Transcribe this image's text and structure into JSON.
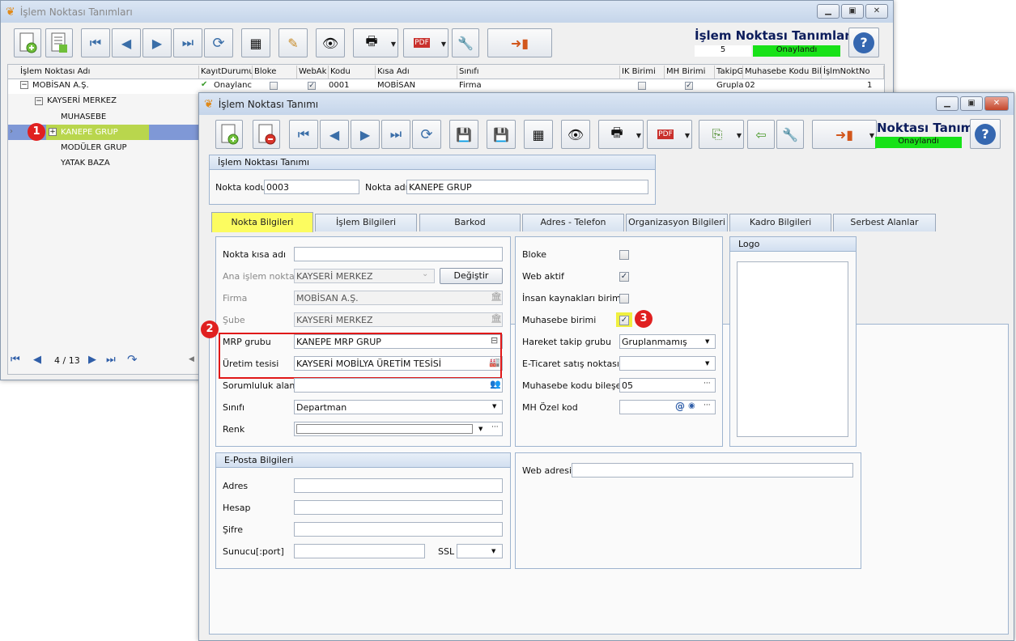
{
  "back_window": {
    "title": "İşlem Noktası Tanımları",
    "header_title": "İşlem Noktası Tanımları",
    "record_count": "5",
    "status": "Onaylandı",
    "columns": [
      "İşlem Noktası Adı",
      "KayıtDurumu",
      "Bloke",
      "WebAk",
      "Kodu",
      "Kısa Adı",
      "Sınıfı",
      "IK Birimi",
      "MH Birimi",
      "TakipG",
      "Muhasebe Kodu Bile",
      "İşlmNoktNo"
    ],
    "first_row": {
      "durum": "Onaylanc",
      "kodu": "0001",
      "kisa_adi": "MOBİSAN",
      "sinifi": "Firma",
      "takip": "Grupla",
      "muh_kodu": "02",
      "no": "1"
    },
    "tree": [
      "MOBİSAN A.Ş.",
      "KAYSERİ MERKEZ",
      "MUHASEBE",
      "KANEPE GRUP",
      "MODÜLER GRUP",
      "YATAK BAZA"
    ],
    "nav_position": "4 / 13"
  },
  "front_window": {
    "title": "İşlem Noktası Tanımı",
    "header_title": "Noktası Tanımı",
    "status": "Onaylandı",
    "section_title": "İşlem Noktası Tanımı",
    "code_label": "Nokta kodu",
    "code_value": "0003",
    "name_label": "Nokta adı",
    "name_value": "KANEPE GRUP",
    "tabs": [
      "Nokta Bilgileri",
      "İşlem Bilgileri",
      "Barkod",
      "Adres - Telefon",
      "Organizasyon Bilgileri",
      "Kadro Bilgileri",
      "Serbest Alanlar"
    ],
    "left": {
      "kisa_adi": "Nokta kısa adı",
      "ana_label": "Ana işlem noktası",
      "ana_value": "KAYSERİ MERKEZ",
      "degistir": "Değiştir",
      "firma_label": "Firma",
      "firma_value": "MOBİSAN A.Ş.",
      "sube_label": "Şube",
      "sube_value": "KAYSERİ MERKEZ",
      "mrp_label": "MRP grubu",
      "mrp_value": "KANEPE MRP GRUP",
      "uretim_label": "Üretim tesisi",
      "uretim_value": "KAYSERİ MOBİLYA ÜRETİM TESİSİ",
      "sorumluluk_label": "Sorumluluk alanı",
      "sinif_label": "Sınıfı",
      "sinif_value": "Departman",
      "renk_label": "Renk"
    },
    "right": {
      "bloke": "Bloke",
      "web": "Web aktif",
      "ik": "İnsan kaynakları birimi",
      "muh": "Muhasebe birimi",
      "hareket_label": "Hareket takip grubu",
      "hareket_value": "Gruplanmamış",
      "eticaret_label": "E-Ticaret satış noktası",
      "muhkod_label": "Muhasebe kodu bileşeni",
      "muhkod_value": "05",
      "mh_label": "MH Özel kod"
    },
    "logo_title": "Logo",
    "eposta": {
      "title": "E-Posta Bilgileri",
      "adres": "Adres",
      "hesap": "Hesap",
      "sifre": "Şifre",
      "sunucu": "Sunucu[:port]",
      "ssl": "SSL"
    },
    "web_label": "Web adresi"
  },
  "annotations": [
    "1",
    "2",
    "3"
  ]
}
